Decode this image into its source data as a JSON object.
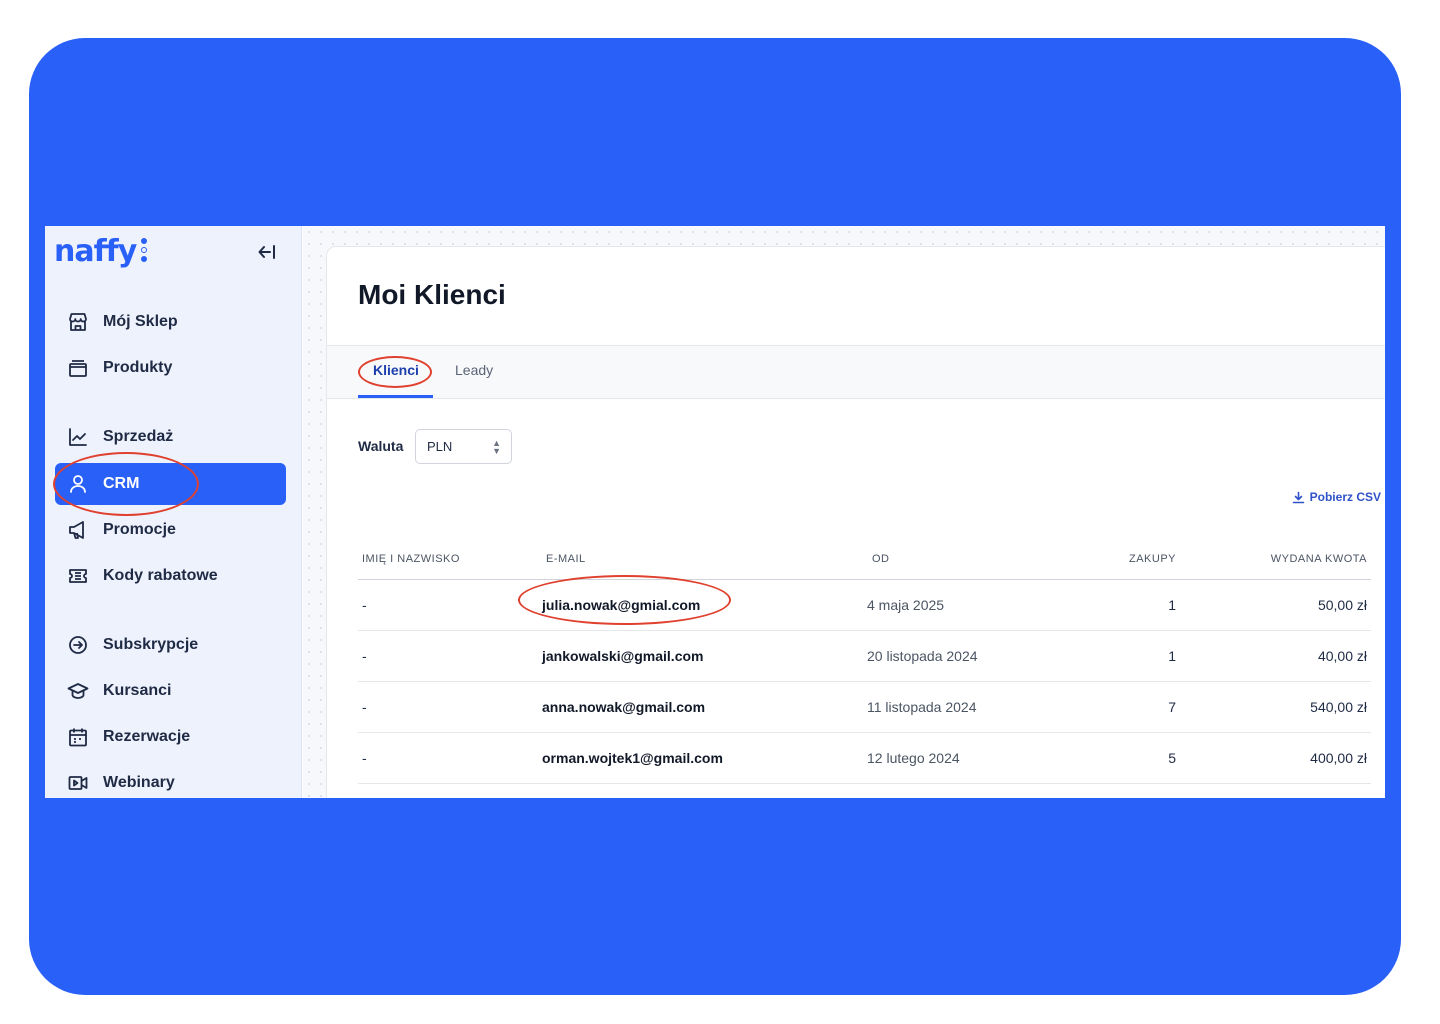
{
  "brand": {
    "name": "naffy",
    "color": "#2960f7",
    "annotation_color": "#e0412f"
  },
  "sidebar": {
    "items": [
      {
        "label": "Mój Sklep",
        "icon": "store-icon"
      },
      {
        "label": "Produkty",
        "icon": "folder-icon"
      },
      {
        "label": "Sprzedaż",
        "icon": "chart-line-icon"
      },
      {
        "label": "CRM",
        "icon": "user-icon",
        "active": true
      },
      {
        "label": "Promocje",
        "icon": "megaphone-icon"
      },
      {
        "label": "Kody rabatowe",
        "icon": "ticket-icon"
      },
      {
        "label": "Subskrypcje",
        "icon": "subscription-icon"
      },
      {
        "label": "Kursanci",
        "icon": "graduation-cap-icon"
      },
      {
        "label": "Rezerwacje",
        "icon": "calendar-icon"
      },
      {
        "label": "Webinary",
        "icon": "video-icon"
      }
    ]
  },
  "main": {
    "title": "Moi Klienci",
    "tabs": [
      {
        "label": "Klienci",
        "active": true
      },
      {
        "label": "Leady"
      }
    ],
    "currency": {
      "label": "Waluta",
      "value": "PLN"
    },
    "csv_label": "Pobierz CSV",
    "table": {
      "columns": [
        "IMIĘ I NAZWISKO",
        "E-MAIL",
        "OD",
        "ZAKUPY",
        "WYDANA KWOTA"
      ],
      "rows": [
        {
          "name": "-",
          "email": "julia.nowak@gmial.com",
          "since": "4 maja 2025",
          "purchases": "1",
          "amount": "50,00 zł"
        },
        {
          "name": "-",
          "email": "jankowalski@gmail.com",
          "since": "20 listopada 2024",
          "purchases": "1",
          "amount": "40,00 zł"
        },
        {
          "name": "-",
          "email": "anna.nowak@gmail.com",
          "since": "11 listopada 2024",
          "purchases": "7",
          "amount": "540,00 zł"
        },
        {
          "name": "-",
          "email": "orman.wojtek1@gmail.com",
          "since": "12 lutego 2024",
          "purchases": "5",
          "amount": "400,00 zł"
        }
      ]
    }
  }
}
